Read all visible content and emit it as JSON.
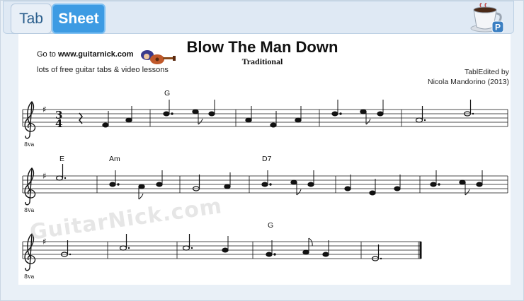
{
  "tabs": [
    {
      "label": "Tab",
      "active": false
    },
    {
      "label": "Sheet",
      "active": true
    }
  ],
  "sheet": {
    "title": "Blow The Man Down",
    "subtitle": "Traditional",
    "goto_prefix": "Go to",
    "goto_site": "www.guitarnick.com",
    "lessons": "lots of free guitar tabs & video lessons",
    "credit_line1": "TablEdited by",
    "credit_line2": "Nicola Mandorino (2013)",
    "watermark": "GuitarNick.com",
    "octave_marking": "8va",
    "time_signature": {
      "top": "3",
      "bottom": "4"
    },
    "chords": [
      "G",
      "E",
      "Am",
      "D7",
      "G"
    ]
  },
  "colors": {
    "tab_active": "#3d9be3",
    "tab_inactive_text": "#2a5e8c",
    "background": "#e9f0f7"
  },
  "icons": [
    "app-cup-icon",
    "guitar-mascot-icon",
    "treble-clef-icon"
  ]
}
